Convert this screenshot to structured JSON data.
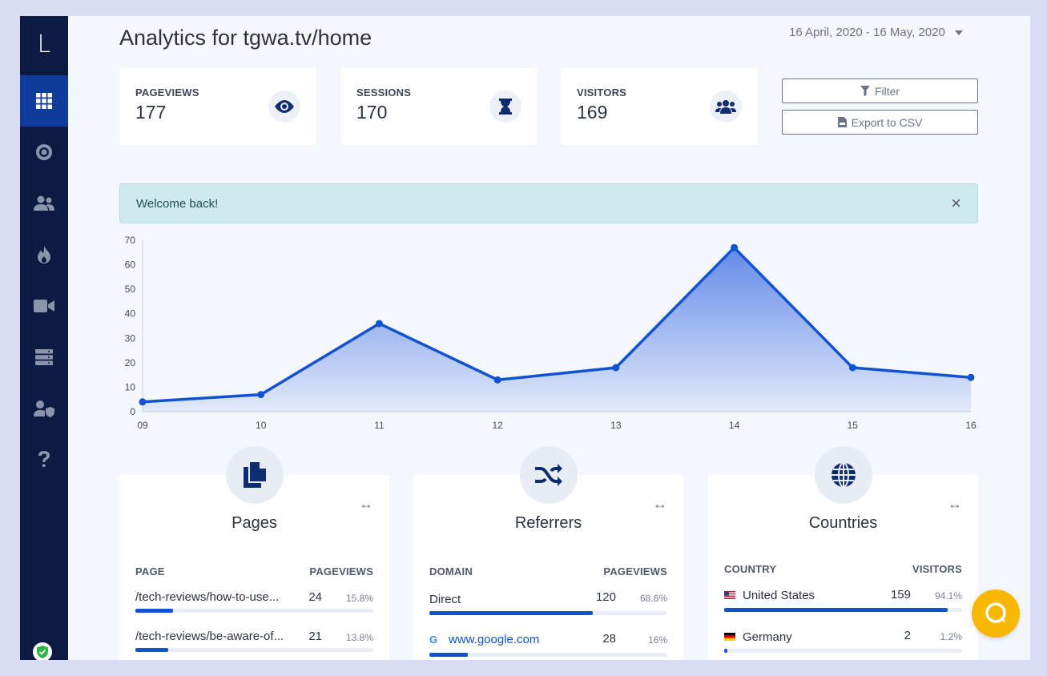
{
  "app": {
    "logo": "L"
  },
  "sidebar": {
    "items": [
      {
        "icon": "grid-icon",
        "active": true
      },
      {
        "icon": "target-icon"
      },
      {
        "icon": "users-icon"
      },
      {
        "icon": "flame-icon"
      },
      {
        "icon": "video-icon"
      },
      {
        "icon": "server-icon"
      },
      {
        "icon": "user-shield-icon"
      },
      {
        "icon": "question-icon"
      }
    ]
  },
  "header": {
    "title": "Analytics for tgwa.tv/home",
    "date_range": "16 April, 2020 - 16 May, 2020"
  },
  "stats": [
    {
      "label": "PAGEVIEWS",
      "value": "177",
      "icon": "eye-icon"
    },
    {
      "label": "SESSIONS",
      "value": "170",
      "icon": "hourglass-icon"
    },
    {
      "label": "VISITORS",
      "value": "169",
      "icon": "users-icon"
    }
  ],
  "actions": {
    "filter": "Filter",
    "export": "Export to CSV"
  },
  "alert": {
    "text": "Welcome back!",
    "close": "×"
  },
  "chart_data": {
    "type": "area",
    "x": [
      "09",
      "10",
      "11",
      "12",
      "13",
      "14",
      "15",
      "16"
    ],
    "values": [
      4,
      7,
      36,
      13,
      18,
      67,
      18,
      14
    ],
    "ylim": [
      0,
      70
    ],
    "yticks": [
      0,
      10,
      20,
      30,
      40,
      50,
      60,
      70
    ],
    "grid": false,
    "colors": {
      "line": "#1152d0",
      "fill": "#5b85e6"
    }
  },
  "panels": {
    "pages": {
      "title": "Pages",
      "col1": "PAGE",
      "col2": "PAGEVIEWS",
      "expand": "↔",
      "rows": [
        {
          "name": "/tech-reviews/how-to-use...",
          "count": "24",
          "pct": "15.8%",
          "fraction": 0.158
        },
        {
          "name": "/tech-reviews/be-aware-of...",
          "count": "21",
          "pct": "13.8%",
          "fraction": 0.138
        }
      ]
    },
    "referrers": {
      "title": "Referrers",
      "col1": "DOMAIN",
      "col2": "PAGEVIEWS",
      "expand": "↔",
      "rows": [
        {
          "name": "Direct",
          "count": "120",
          "pct": "68.6%",
          "fraction": 0.686
        },
        {
          "name": "www.google.com",
          "count": "28",
          "pct": "16%",
          "fraction": 0.16,
          "icon": "google-icon"
        }
      ]
    },
    "countries": {
      "title": "Countries",
      "col1": "COUNTRY",
      "col2": "VISITORS",
      "expand": "↔",
      "rows": [
        {
          "name": "United States",
          "count": "159",
          "pct": "94.1%",
          "fraction": 0.941,
          "icon": "us-flag-icon"
        },
        {
          "name": "Germany",
          "count": "2",
          "pct": "1.2%",
          "fraction": 0.012,
          "icon": "de-flag-icon"
        }
      ]
    }
  },
  "colors": {
    "accent": "#1152d0",
    "sidebar": "#0d1b42",
    "sidebar_active": "#0f3b9a",
    "chat": "#f8b700"
  }
}
